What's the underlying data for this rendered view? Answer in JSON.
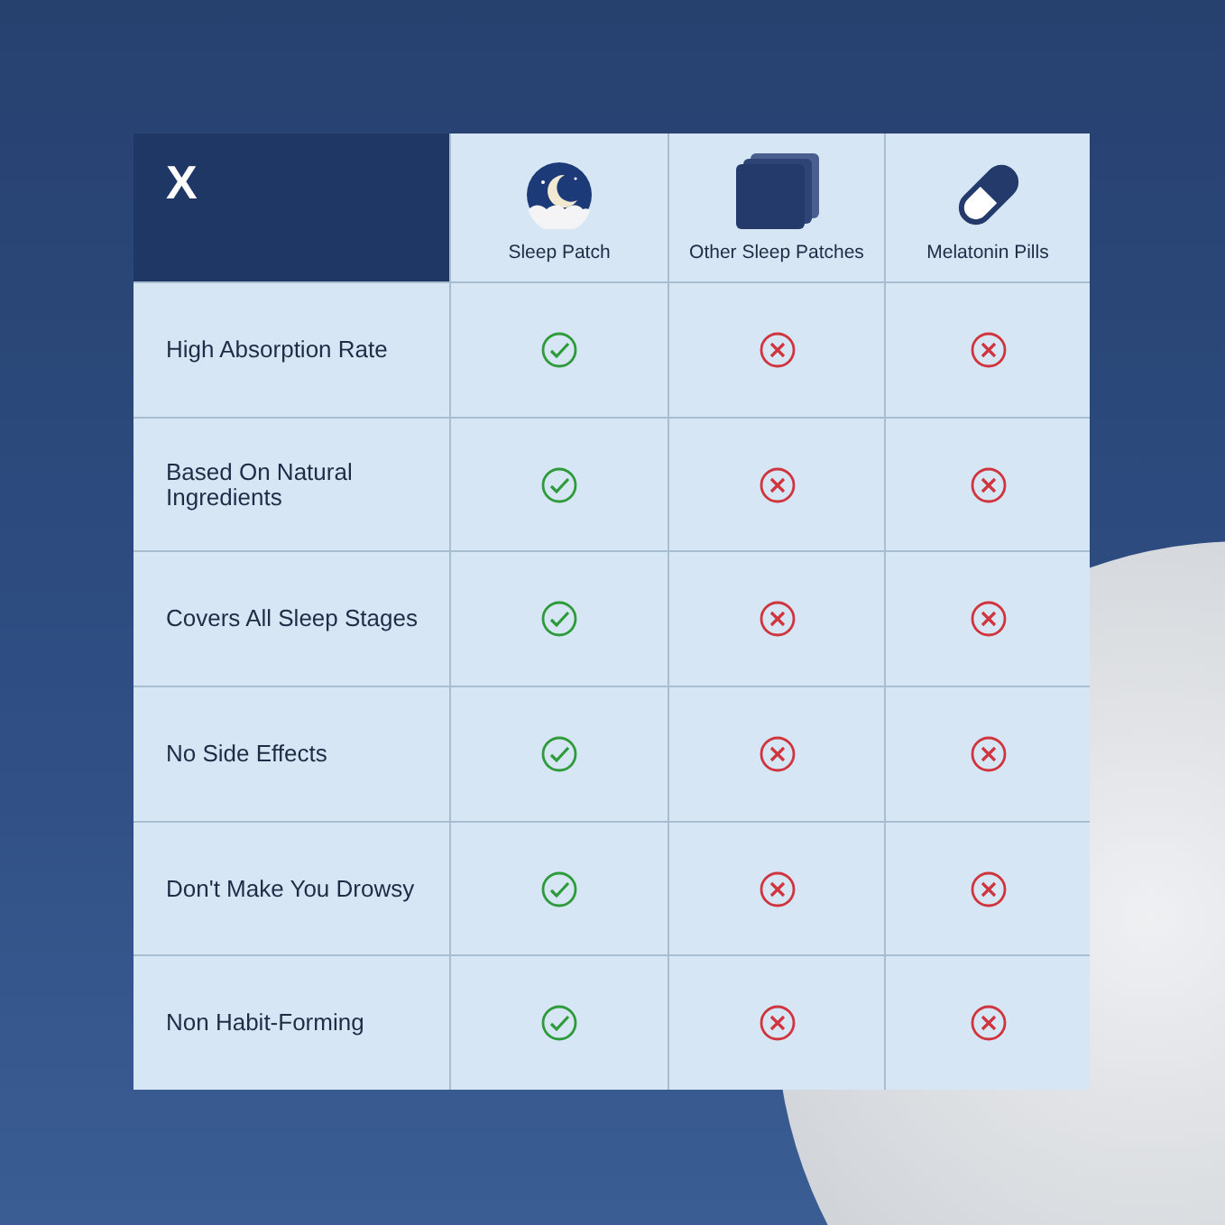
{
  "logo": "X",
  "products": [
    {
      "name": "Sleep Patch",
      "kind": "moon"
    },
    {
      "name": "Other Sleep Patches",
      "kind": "patches"
    },
    {
      "name": "Melatonin Pills",
      "kind": "pill"
    }
  ],
  "features": [
    {
      "label": "High Absorption Rate",
      "has": [
        true,
        false,
        false
      ]
    },
    {
      "label": "Based On Natural Ingredients",
      "has": [
        true,
        false,
        false
      ]
    },
    {
      "label": "Covers All Sleep Stages",
      "has": [
        true,
        false,
        false
      ]
    },
    {
      "label": "No Side Effects",
      "has": [
        true,
        false,
        false
      ]
    },
    {
      "label": "Don't Make You Drowsy",
      "has": [
        true,
        false,
        false
      ]
    },
    {
      "label": "Non Habit-Forming",
      "has": [
        true,
        false,
        false
      ]
    }
  ]
}
